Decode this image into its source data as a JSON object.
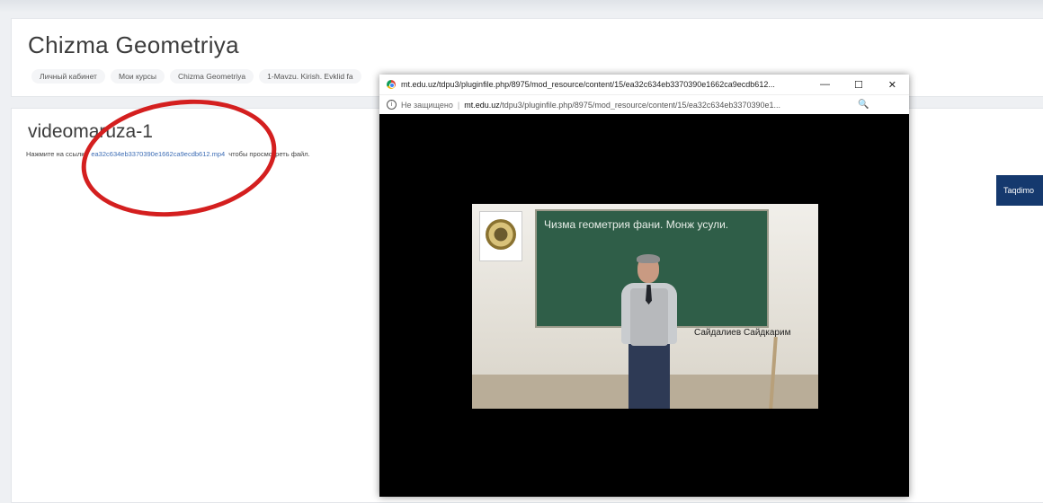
{
  "header": {
    "title": "Chizma Geometriya",
    "breadcrumb": [
      "Личный кабинет",
      "Мои курсы",
      "Chizma Geometriya",
      "1-Mavzu. Kirish. Evklid fa"
    ]
  },
  "resource": {
    "title": "videomaruza-1",
    "desc_prefix": "Нажмите на ссылку",
    "file_link": "ea32c634eb3370390e1662ca9ecdb612.mp4",
    "desc_suffix": "чтобы просмотреть файл."
  },
  "side_button": {
    "label": "Taqdimo"
  },
  "popup": {
    "title": "mt.edu.uz/tdpu3/pluginfile.php/8975/mod_resource/content/15/ea32c634eb3370390e1662ca9ecdb612...",
    "not_secure": "Не защищено",
    "url_domain": "mt.edu.uz",
    "url_path": "/tdpu3/pluginfile.php/8975/mod_resource/content/15/ea32c634eb3370390e1...",
    "minimize": "—",
    "maximize": "☐",
    "close": "✕",
    "zoom": "🔍"
  },
  "video": {
    "board_text": "Чизма геометрия фани. Монж усули.",
    "lecturer": "Сайдалиев Сайдкарим"
  },
  "icons": {
    "chrome": "chrome-icon",
    "info": "info-icon",
    "zoom": "zoom-icon"
  },
  "colors": {
    "highlight_ellipse": "#d41f1f",
    "side_button": "#15396e",
    "link": "#3d6db5"
  }
}
